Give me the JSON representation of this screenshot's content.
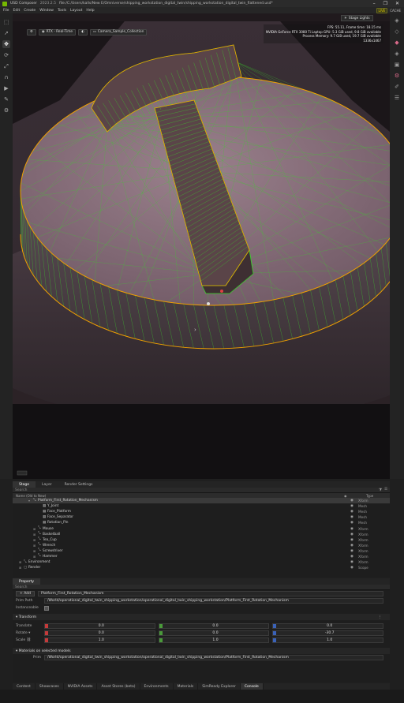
{
  "window": {
    "app_title": "USD Composer",
    "version": "2023.2.5",
    "file_path": "file:/C:/Users/kalls/New E/Omniverse/shipping_workstation_digital_twin/shipping_workstation_digital_twin_flattened.usd*",
    "controls": [
      "–",
      "❐",
      "✕"
    ]
  },
  "menu": {
    "items": [
      "File",
      "Edit",
      "Create",
      "Window",
      "Tools",
      "Layout",
      "Help"
    ],
    "live_label": "LIVE",
    "cache_label": "CACHE"
  },
  "viewport": {
    "renderer_label": "RTX - Real-Time",
    "camera_label": "Camera_Sample_Collection",
    "stage_lights_label": "Stage Lights",
    "stats": [
      "FPS: 55.11, Frame time: 18.15 ms",
      "NVIDIA GeForce RTX 3080 Ti Laptop GPU: 5.3 GiB used, 9.8 GiB available",
      "Process Memory: 9.7 GiB used, 19.7 GiB available",
      "1336x1467"
    ]
  },
  "panel_tabs": [
    "Stage",
    "Layer",
    "Render Settings"
  ],
  "stage": {
    "search_placeholder": "Search",
    "col_name": "Name (Old to New)",
    "col_type": "Type",
    "rows": [
      {
        "name": "Platform_First_Rotation_Mechanism",
        "type": "Xform",
        "depth": 3,
        "expander": "▾",
        "icon": "⤡",
        "selected": true
      },
      {
        "name": "Y_Joint",
        "type": "Mesh",
        "depth": 5,
        "expander": "",
        "icon": "▦",
        "selected": false
      },
      {
        "name": "Face_Platform",
        "type": "Mesh",
        "depth": 5,
        "expander": "",
        "icon": "▦",
        "selected": false
      },
      {
        "name": "Face_Separator",
        "type": "Mesh",
        "depth": 5,
        "expander": "",
        "icon": "▦",
        "selected": false
      },
      {
        "name": "Rotation_Pin",
        "type": "Mesh",
        "depth": 5,
        "expander": "",
        "icon": "▦",
        "selected": false
      },
      {
        "name": "Mouse",
        "type": "Xform",
        "depth": 4,
        "expander": "⊞",
        "icon": "⤡",
        "selected": false
      },
      {
        "name": "Basketball",
        "type": "Xform",
        "depth": 4,
        "expander": "⊞",
        "icon": "⤡",
        "selected": false
      },
      {
        "name": "Tea_Cup",
        "type": "Xform",
        "depth": 4,
        "expander": "⊞",
        "icon": "⤡",
        "selected": false
      },
      {
        "name": "Wrench",
        "type": "Xform",
        "depth": 4,
        "expander": "⊞",
        "icon": "⤡",
        "selected": false
      },
      {
        "name": "Screwdriver",
        "type": "Xform",
        "depth": 4,
        "expander": "⊞",
        "icon": "⤡",
        "selected": false
      },
      {
        "name": "Hammer",
        "type": "Xform",
        "depth": 4,
        "expander": "⊞",
        "icon": "⤡",
        "selected": false
      },
      {
        "name": "Environment",
        "type": "Xform",
        "depth": 1,
        "expander": "⊞",
        "icon": "⤡",
        "selected": false
      },
      {
        "name": "Render",
        "type": "Scope",
        "depth": 1,
        "expander": "⊞",
        "icon": "▢",
        "selected": false
      }
    ]
  },
  "property": {
    "tab": "Property",
    "search_placeholder": "Search",
    "add_label": "Add",
    "prim_name": "Platform_First_Rotation_Mechanism",
    "prim_path_label": "Prim Path",
    "prim_path": "/World/operational_digital_twin_shipping_workstation/operational_digital_twin_shipping_workstation/Platform_First_Rotation_Mechanism",
    "instanceable_label": "Instanceable",
    "transform_label": "Transform",
    "translate_label": "Translate",
    "translate": [
      "0.0",
      "0.0",
      "0.0"
    ],
    "rotate_label": "Rotate ▾",
    "rotate": [
      "0.0",
      "0.0",
      "-30.7"
    ],
    "scale_label": "Scale ⛓",
    "scale": [
      "1.0",
      "1.0",
      "1.0"
    ],
    "materials_label": "Materials on selected models",
    "prim_label": "Prim",
    "material_path": "/World/operational_digital_twin_shipping_workstation/operational_digital_twin_shipping_workstation/Platform_First_Rotation_Mechanism"
  },
  "bottom_tabs": [
    "Content",
    "Showcases",
    "NVIDIA Assets",
    "Asset Stores (beta)",
    "Environments",
    "Materials",
    "SimReady Explorer",
    "Console"
  ],
  "colors": {
    "wire": "#39d42a",
    "selection_outline": "#f0a000",
    "platform_top": "#7c6470",
    "accent_live": "#e8d400"
  }
}
